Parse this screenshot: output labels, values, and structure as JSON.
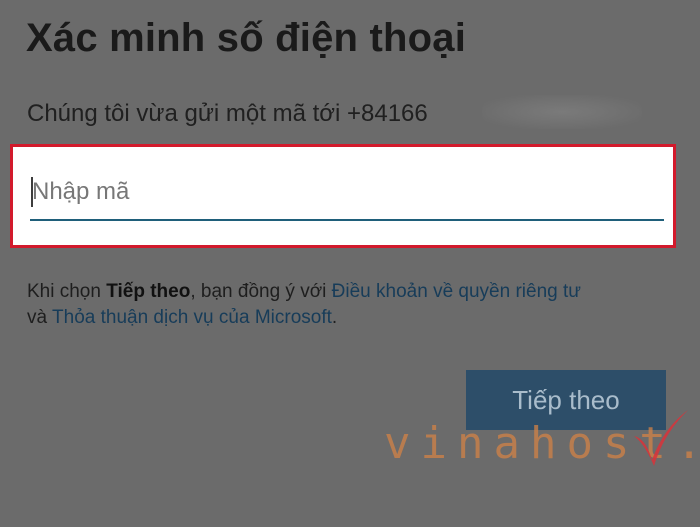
{
  "page": {
    "title": "Xác minh số điện thoại",
    "sent_prefix": "Chúng tôi vừa gửi một mã tới +84166"
  },
  "code_input": {
    "placeholder": "Nhập mã",
    "value": ""
  },
  "terms": {
    "text_1": "Khi chọn ",
    "bold_1": "Tiếp theo",
    "text_2": ", bạn đồng ý với ",
    "privacy_link": "Điều khoản về quyền riêng tư",
    "text_3": "và ",
    "services_link": "Thỏa thuận dịch vụ của Microsoft",
    "text_4": "."
  },
  "actions": {
    "next_label": "Tiếp theo"
  },
  "watermark": {
    "text": "vinahost."
  },
  "colors": {
    "overlay": "#6b6b6b",
    "highlight_border": "#d21a2c",
    "button_bg": "#2d4e69",
    "link": "#173c59",
    "watermark": "#d28246",
    "watermark_check": "#d9323a"
  }
}
